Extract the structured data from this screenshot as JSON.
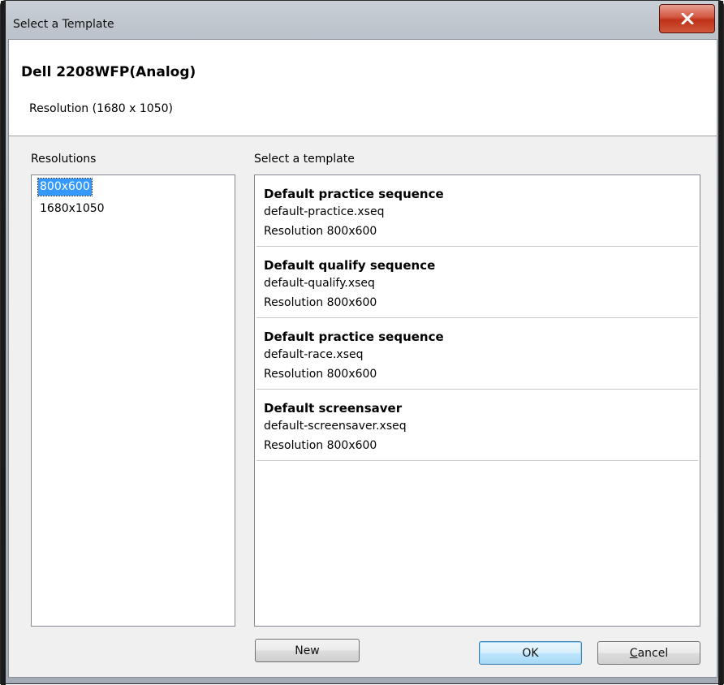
{
  "window": {
    "title": "Select a Template",
    "close_icon": "close-icon"
  },
  "header": {
    "monitor_name": "Dell 2208WFP(Analog)",
    "resolution_info": "Resolution (1680 x 1050)"
  },
  "resolutions": {
    "label": "Resolutions",
    "items": [
      {
        "label": "800x600",
        "selected": true
      },
      {
        "label": "1680x1050",
        "selected": false
      }
    ]
  },
  "templates": {
    "label": "Select a template",
    "items": [
      {
        "name": "Default practice sequence",
        "file": "default-practice.xseq",
        "resolution": "Resolution 800x600"
      },
      {
        "name": "Default qualify sequence",
        "file": "default-qualify.xseq",
        "resolution": "Resolution 800x600"
      },
      {
        "name": "Default practice sequence",
        "file": "default-race.xseq",
        "resolution": "Resolution 800x600"
      },
      {
        "name": "Default screensaver",
        "file": "default-screensaver.xseq",
        "resolution": "Resolution 800x600"
      }
    ]
  },
  "buttons": {
    "new_label": "New",
    "ok_label": "OK",
    "cancel_label": "Cancel",
    "cancel_accesskey": "C"
  },
  "colors": {
    "selection": "#3399ff",
    "close_button": "#c7432a"
  }
}
